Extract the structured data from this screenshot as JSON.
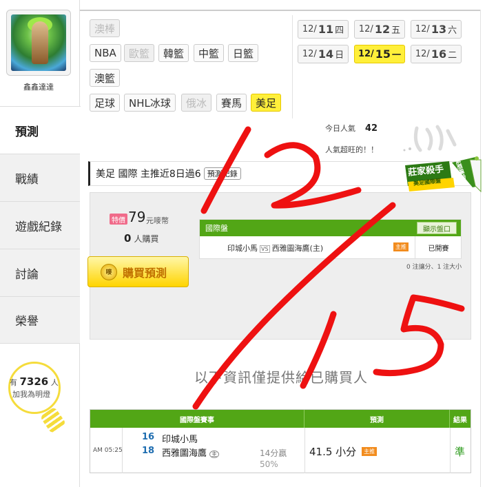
{
  "profile": {
    "username": "鑫鑫達達"
  },
  "nav": [
    "預測",
    "戰績",
    "遊戲紀錄",
    "討論",
    "榮譽"
  ],
  "fans": {
    "prefix": "有",
    "count": "7326",
    "suffix": "人",
    "cta": "加我為明燈"
  },
  "sports": {
    "row1": [
      "澳棒"
    ],
    "row2": [
      "NBA",
      "歐籃",
      "韓籃",
      "中籃",
      "日籃"
    ],
    "row3": [
      "澳籃"
    ],
    "row4": [
      "足球",
      "NHL冰球",
      "俄冰",
      "賽馬",
      "美足"
    ]
  },
  "dates": [
    {
      "md": "12/",
      "day": "11",
      "wd": "四"
    },
    {
      "md": "12/",
      "day": "12",
      "wd": "五"
    },
    {
      "md": "12/",
      "day": "13",
      "wd": "六"
    },
    {
      "md": "12/",
      "day": "14",
      "wd": "日"
    },
    {
      "md": "12/",
      "day": "15",
      "wd": "一"
    },
    {
      "md": "12/",
      "day": "16",
      "wd": "二"
    }
  ],
  "popularity": {
    "label": "今日人氣",
    "value": "42",
    "sub": "人氣超旺的！！"
  },
  "prediction": {
    "title": "美足 國際 主推近8日過6",
    "record_btn": "預測記錄",
    "special": "特價",
    "price": "79",
    "price_unit": "元嘜幣",
    "buyers_count": "0",
    "buyers_label": "人購買",
    "buy_label": "購買預測",
    "coin_label": "嘜"
  },
  "badge": {
    "main": "莊家殺手",
    "sub": "美足國際盤",
    "ribbon": "長期穩定"
  },
  "market": {
    "title": "國際盤",
    "show_btn": "顯示盤口",
    "away": "印城小馬",
    "vs": "VS",
    "home": "西雅圖海鷹(主)",
    "host_tag": "主推",
    "status": "已開賽",
    "note": "0 注讓分、1 注大小"
  },
  "info_message": "以下資訊僅提供給已購買人",
  "results": {
    "headers": [
      "國際盤賽事",
      "預測",
      "結果"
    ],
    "time": "AM 05:25",
    "away_score": "16",
    "away_team": "印城小馬",
    "home_score": "18",
    "home_team": "西雅圖海鷹",
    "home_mark": "主",
    "margin": "14分贏",
    "pct": "50%",
    "pick": "41.5 小分",
    "pick_tag": "主推",
    "result": "準"
  },
  "colors": {
    "green": "#52a616",
    "yellow": "#ffef3a",
    "annotation_red": "#ee1111"
  }
}
